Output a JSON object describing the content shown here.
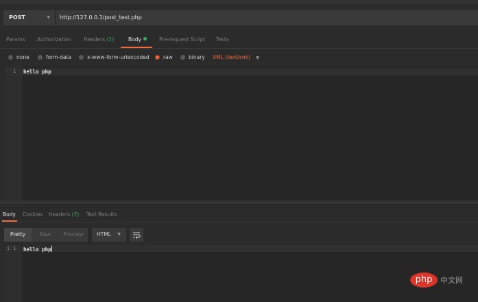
{
  "request": {
    "method": "POST",
    "url": "http://127.0.0.1/post_test.php"
  },
  "request_tabs": [
    {
      "label": "Params"
    },
    {
      "label": "Authorization"
    },
    {
      "label": "Headers",
      "count": "(1)"
    },
    {
      "label": "Body"
    },
    {
      "label": "Pre-request Script"
    },
    {
      "label": "Tests"
    }
  ],
  "body_types": {
    "none": "none",
    "form_data": "form-data",
    "urlencoded": "x-www-form-urlencoded",
    "raw": "raw",
    "binary": "binary",
    "selected": "raw",
    "content_type": "XML (text/xml)"
  },
  "request_editor": {
    "line_number": "1",
    "code": "hello php"
  },
  "response_tabs": [
    {
      "label": "Body"
    },
    {
      "label": "Cookies"
    },
    {
      "label": "Headers",
      "count": "(7)"
    },
    {
      "label": "Test Results"
    }
  ],
  "response_view": {
    "pretty": "Pretty",
    "raw": "Raw",
    "preview": "Preview",
    "format": "HTML"
  },
  "response_editor": {
    "fold_marker": "i",
    "line_number": "1",
    "code": "hello php"
  },
  "watermark": {
    "logo": "php",
    "text": "中文网"
  },
  "colors": {
    "accent": "#f26b3a",
    "success": "#3fa96b",
    "background": "#2b2b2b"
  }
}
